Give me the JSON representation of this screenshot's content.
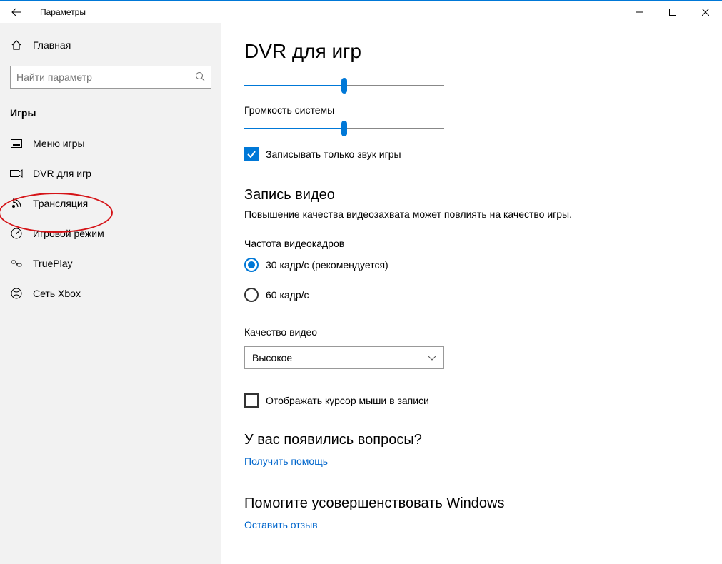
{
  "titlebar": {
    "title": "Параметры"
  },
  "sidebar": {
    "home_label": "Главная",
    "search_placeholder": "Найти параметр",
    "section_header": "Игры",
    "items": [
      {
        "label": "Меню игры"
      },
      {
        "label": "DVR для игр"
      },
      {
        "label": "Трансляция"
      },
      {
        "label": "Игровой режим"
      },
      {
        "label": "TruePlay"
      },
      {
        "label": "Сеть Xbox"
      }
    ]
  },
  "content": {
    "page_title": "DVR для игр",
    "slider1_value": 50,
    "slider2_label": "Громкость системы",
    "slider2_value": 50,
    "checkbox1_label": "Записывать только звук игры",
    "checkbox1_checked": true,
    "section_record_title": "Запись видео",
    "section_record_desc": "Повышение качества видеозахвата может повлиять на качество игры.",
    "framerate_label": "Частота видеокадров",
    "fps30_label": "30 кадр/с (рекомендуется)",
    "fps60_label": "60 кадр/с",
    "fps_selected": "30",
    "quality_label": "Качество видео",
    "quality_value": "Высокое",
    "cursor_checkbox_label": "Отображать курсор мыши в записи",
    "cursor_checkbox_checked": false,
    "questions_title": "У вас появились вопросы?",
    "help_link": "Получить помощь",
    "feedback_title": "Помогите усовершенствовать Windows",
    "feedback_link": "Оставить отзыв"
  }
}
